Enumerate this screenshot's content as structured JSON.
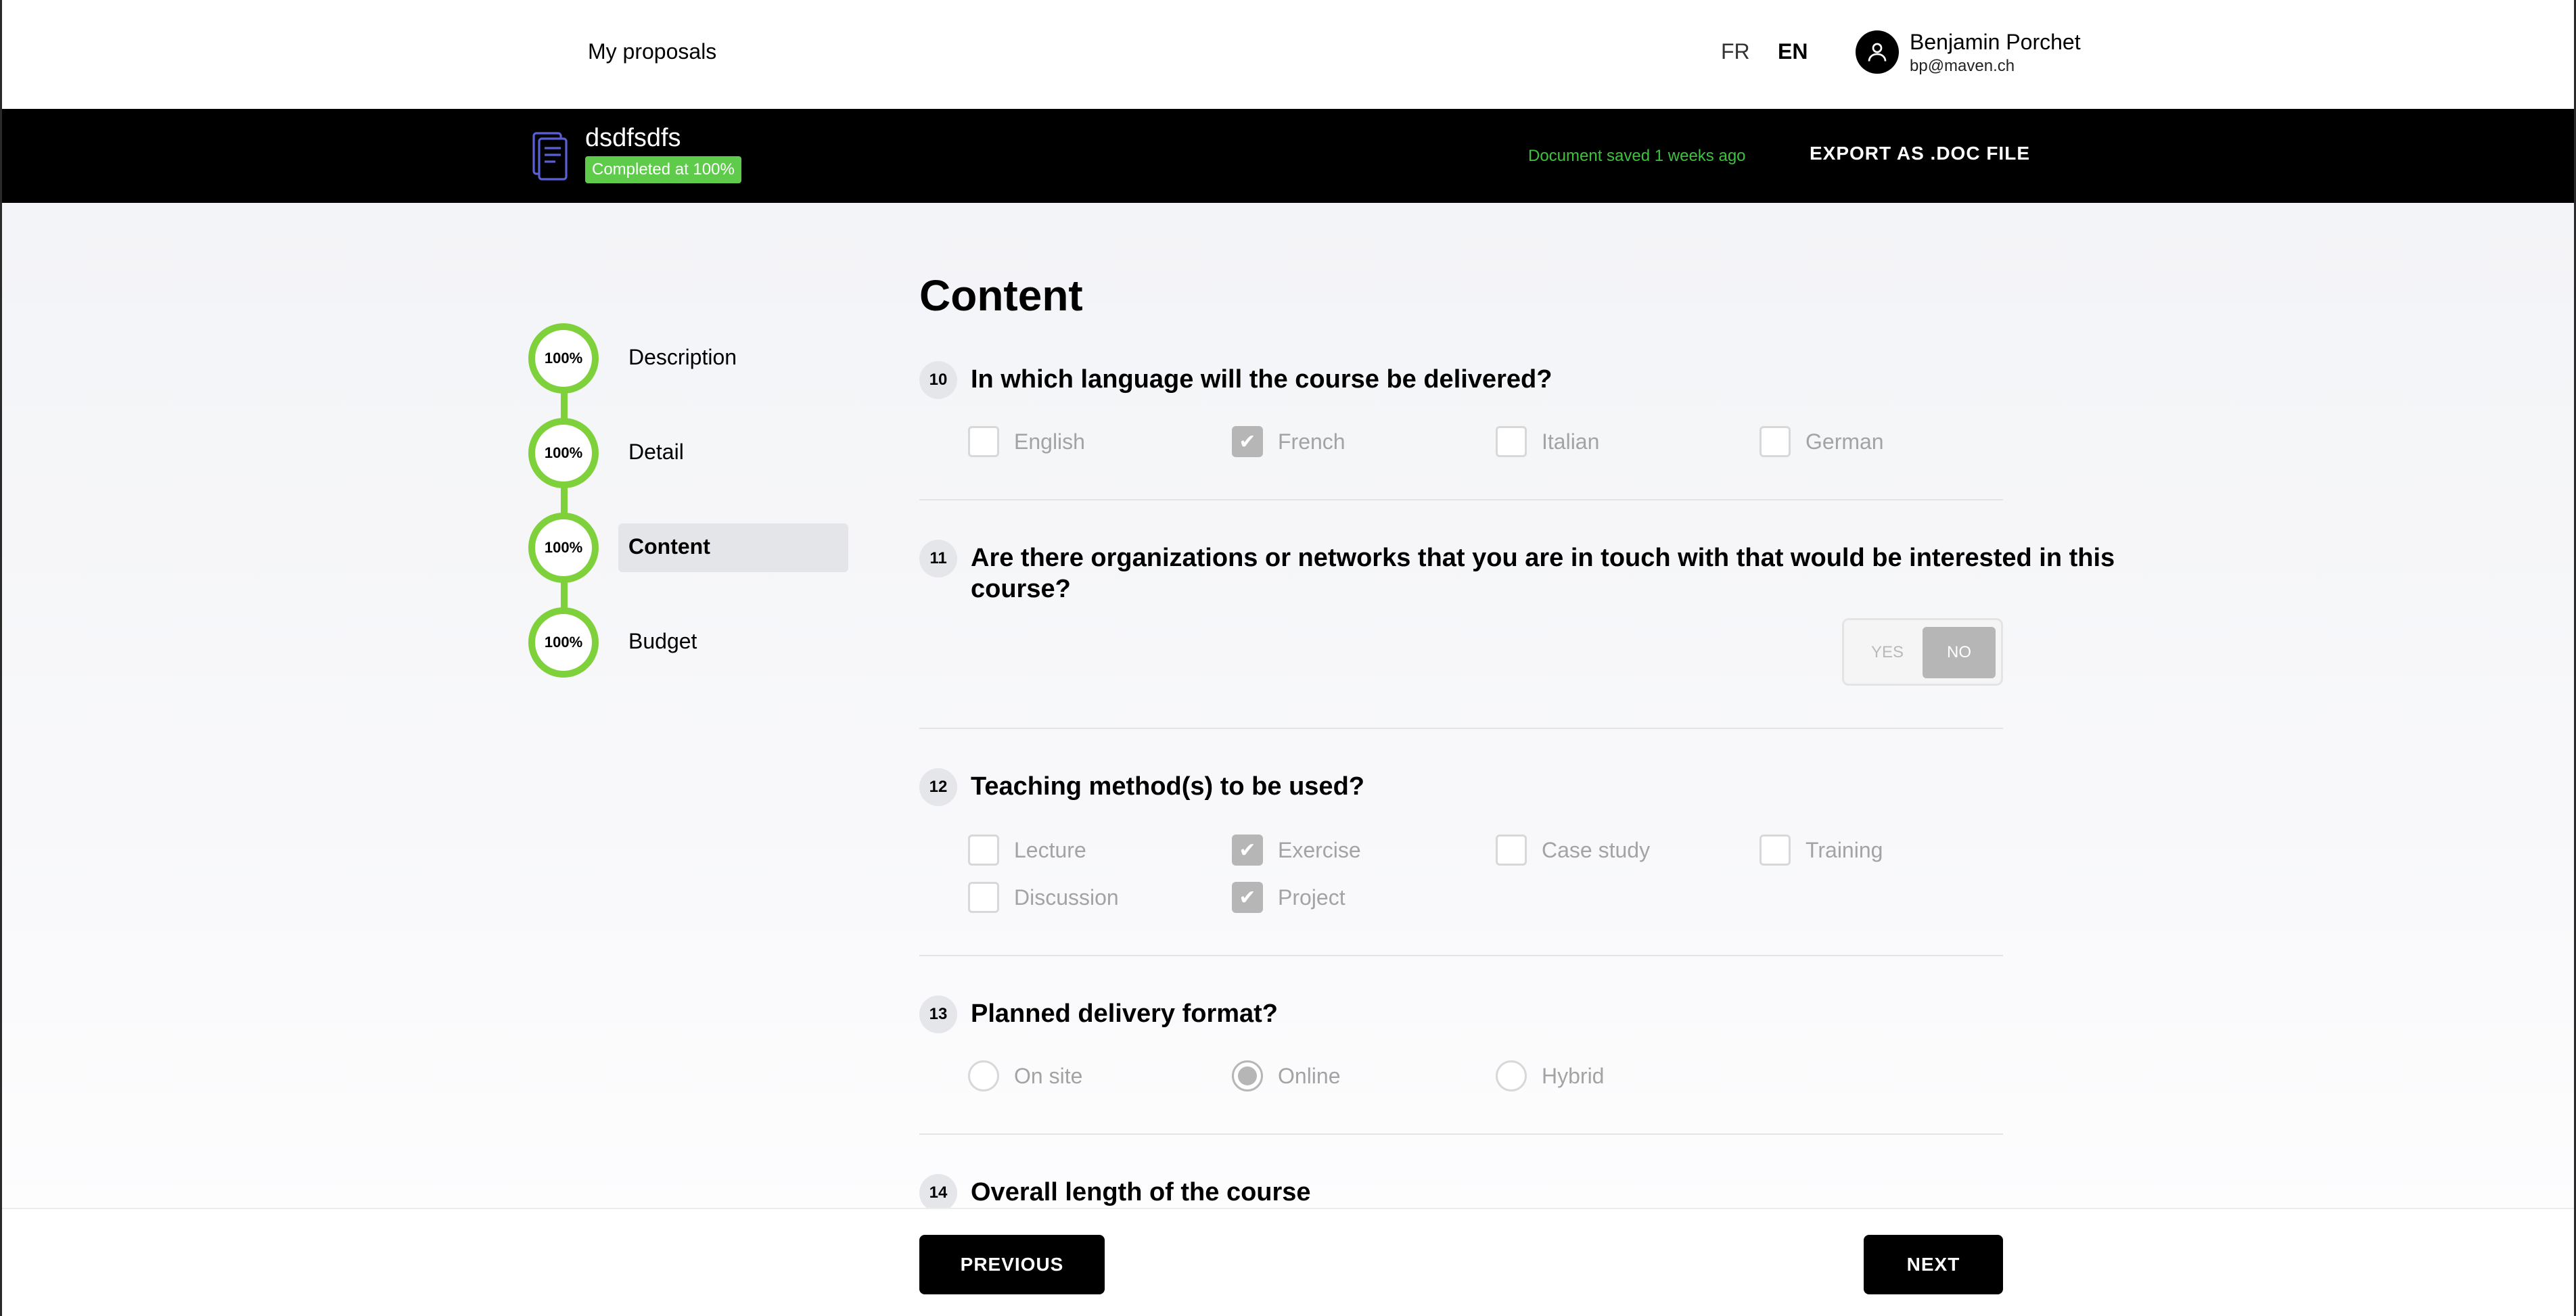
{
  "topnav": {
    "my_proposals": "My proposals",
    "lang_fr": "FR",
    "lang_en": "EN",
    "user_name": "Benjamin Porchet",
    "user_email": "bp@maven.ch"
  },
  "document": {
    "title": "dsdfsdfs",
    "badge": "Completed at 100%",
    "saved_status": "Document saved 1 weeks ago",
    "export_label": "EXPORT AS .DOC FILE"
  },
  "steps": [
    {
      "percent": "100%",
      "label": "Description"
    },
    {
      "percent": "100%",
      "label": "Detail"
    },
    {
      "percent": "100%",
      "label": "Content"
    },
    {
      "percent": "100%",
      "label": "Budget"
    }
  ],
  "active_step": "Content",
  "section_title": "Content",
  "questions": {
    "q10": {
      "num": "10",
      "text": "In which language will the course be delivered?",
      "options": [
        {
          "label": "English",
          "checked": false
        },
        {
          "label": "French",
          "checked": true
        },
        {
          "label": "Italian",
          "checked": false
        },
        {
          "label": "German",
          "checked": false
        }
      ]
    },
    "q11": {
      "num": "11",
      "text_line1": "Are there organizations or networks that you are in touch with that would be interested in this",
      "text_line2": "course?",
      "yes": "YES",
      "no": "NO",
      "selected": "NO"
    },
    "q12": {
      "num": "12",
      "text": "Teaching method(s) to be used?",
      "options": [
        {
          "label": "Lecture",
          "checked": false
        },
        {
          "label": "Exercise",
          "checked": true
        },
        {
          "label": "Case study",
          "checked": false
        },
        {
          "label": "Training",
          "checked": false
        },
        {
          "label": "Discussion",
          "checked": false
        },
        {
          "label": "Project",
          "checked": true
        }
      ]
    },
    "q13": {
      "num": "13",
      "text": "Planned delivery format?",
      "options": [
        {
          "label": "On site",
          "checked": false
        },
        {
          "label": "Online",
          "checked": true
        },
        {
          "label": "Hybrid",
          "checked": false
        }
      ]
    },
    "q14": {
      "num": "14",
      "text": "Overall length of the course"
    }
  },
  "footer": {
    "previous": "PREVIOUS",
    "next": "NEXT"
  },
  "colors": {
    "accent_green": "#7fd13b",
    "badge_green": "#5ecb4a",
    "saved_green": "#3ec13e",
    "checked_gray": "#b6b6b6"
  },
  "icons": {
    "avatar": "user-icon",
    "document": "document-icon",
    "check": "check-icon"
  }
}
